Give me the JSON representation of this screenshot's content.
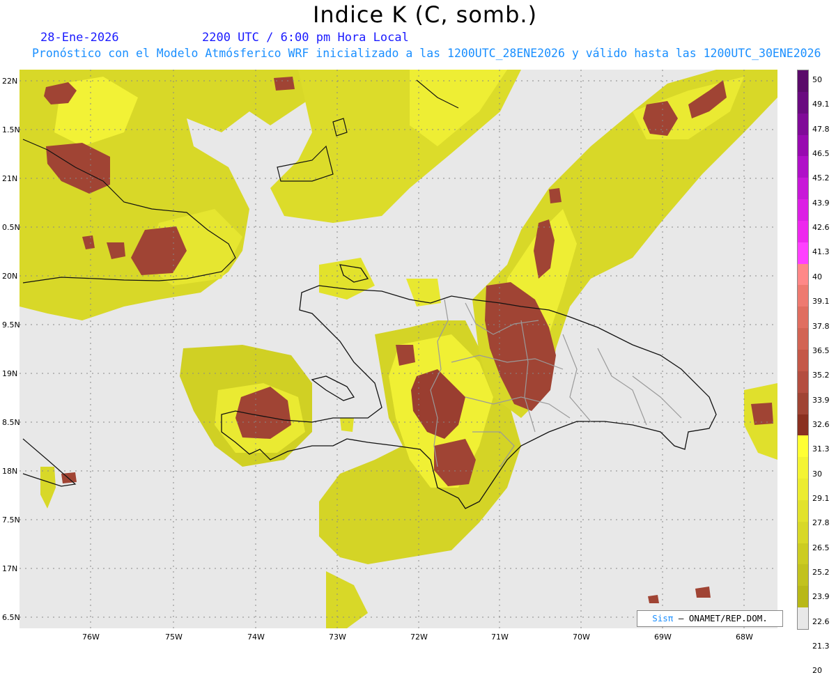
{
  "header": {
    "title": "Indice K (C, somb.)",
    "date": "28-Ene-2026",
    "time": "2200 UTC / 6:00 pm Hora Local",
    "subtitle": "Pronóstico con el Modelo Atmósferico WRF inicializado a las 1200UTC_28ENE2026 y válido hasta las  1200UTC_30ENE2026"
  },
  "axes": {
    "lat_labels": [
      "22N",
      "1.5N",
      "21N",
      "0.5N",
      "20N",
      "9.5N",
      "19N",
      "8.5N",
      "18N",
      "7.5N",
      "17N",
      "6.5N"
    ],
    "lon_labels": [
      "76W",
      "75W",
      "74W",
      "73W",
      "72W",
      "71W",
      "70W",
      "69W",
      "68W"
    ]
  },
  "legend": {
    "labels": [
      "50",
      "49.1",
      "47.8",
      "46.5",
      "45.2",
      "43.9",
      "42.6",
      "41.3",
      "40",
      "39.1",
      "37.8",
      "36.5",
      "35.2",
      "33.9",
      "32.6",
      "31.3",
      "30",
      "29.1",
      "27.8",
      "26.5",
      "25.2",
      "23.9",
      "22.6",
      "21.3",
      "20"
    ],
    "colors": [
      "#5a0a6a",
      "#6a0a80",
      "#800a98",
      "#980ab0",
      "#b010c8",
      "#c818d8",
      "#dc20e4",
      "#ee28ee",
      "#ff40ff",
      "#ff8888",
      "#ee7a70",
      "#e06e60",
      "#d26454",
      "#c45848",
      "#b44e40",
      "#a04434",
      "#8a3020",
      "#ffff33",
      "#f4f433",
      "#ecec30",
      "#e2e22c",
      "#d8d828",
      "#cccc22",
      "#c2c21e",
      "#b8b818",
      "#e8e8e8"
    ]
  },
  "credit": {
    "brand": "Sisπ",
    "text": " – ONAMET/REP.DOM."
  }
}
